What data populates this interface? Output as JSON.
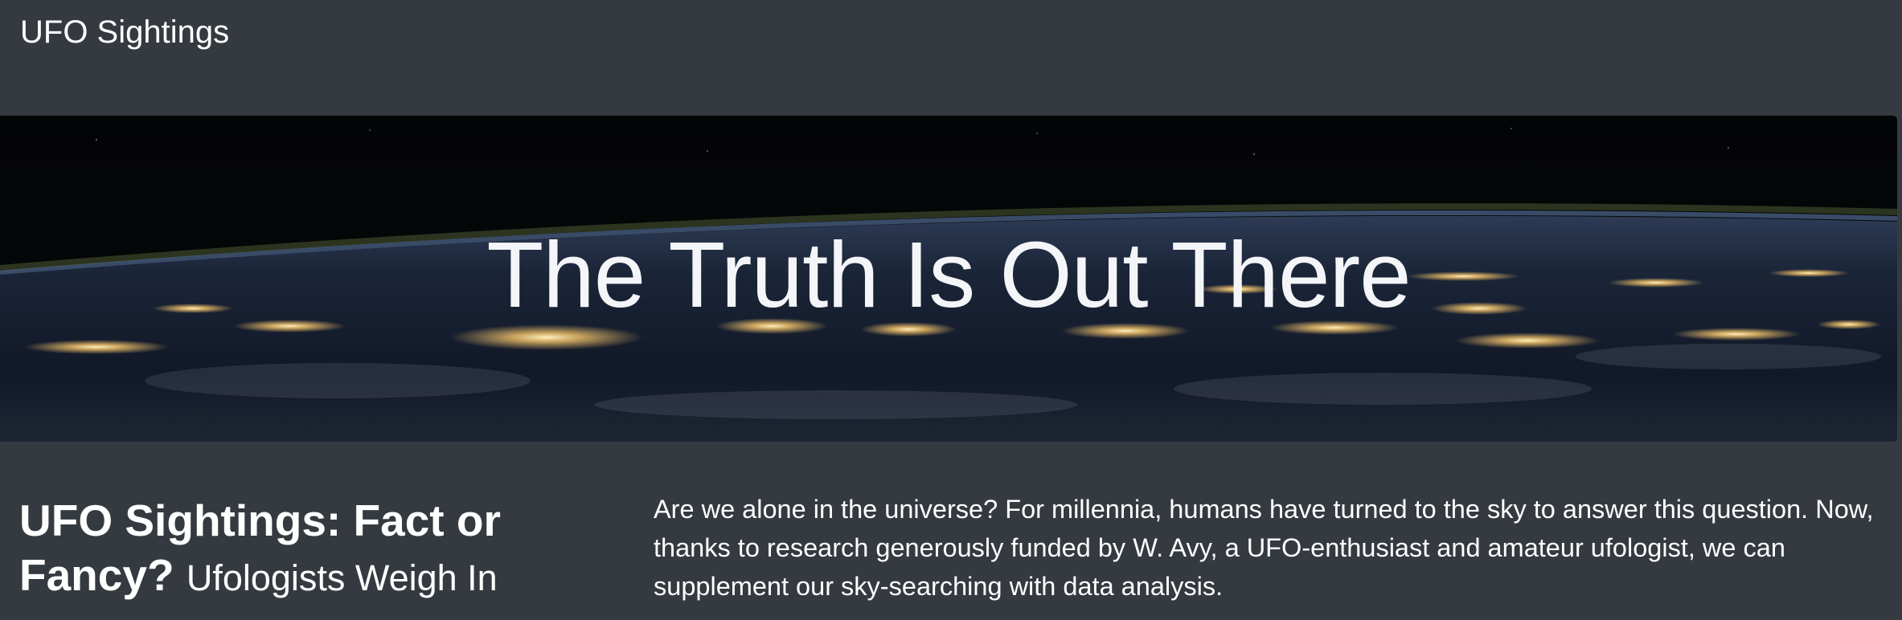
{
  "navbar": {
    "brand": "UFO Sightings"
  },
  "hero": {
    "title": "The Truth Is Out There",
    "background_image": "earth-at-night-from-space"
  },
  "article": {
    "headline": "UFO Sightings: Fact or Fancy?",
    "subheadline": "Ufologists Weigh In",
    "intro": "Are we alone in the universe? For millennia, humans have turned to the sky to answer this question. Now, thanks to research generously funded by W. Avy, a UFO-enthusiast and amateur ufologist, we can supplement our sky-searching with data analysis."
  },
  "colors": {
    "page_background": "#343a40",
    "text": "#ffffff",
    "hero_space": "#050607",
    "city_lights": "#f5c46a"
  }
}
